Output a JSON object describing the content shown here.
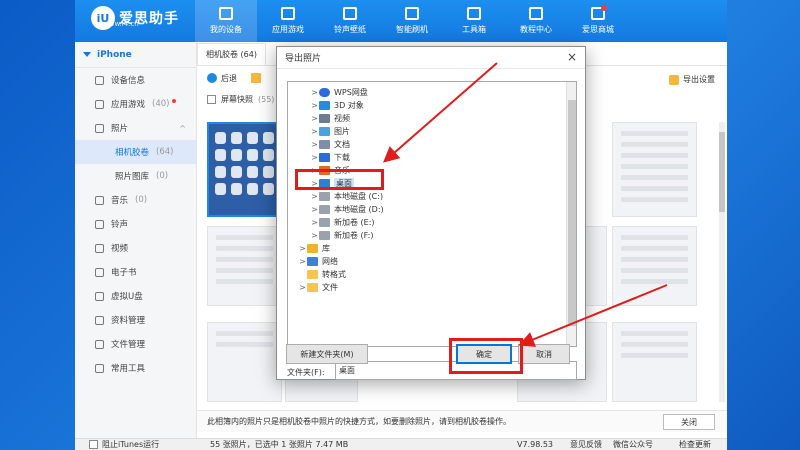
{
  "app": {
    "logo_text": "爱思助手",
    "logo_url": "www.i4.cn",
    "logo_mark": "iU",
    "nav": [
      {
        "label": "我的设备",
        "icon": "device-icon",
        "active": true
      },
      {
        "label": "应用游戏",
        "icon": "apps-icon",
        "active": false
      },
      {
        "label": "铃声壁纸",
        "icon": "music-icon",
        "active": false
      },
      {
        "label": "智能刷机",
        "icon": "flash-icon",
        "active": false
      },
      {
        "label": "工具箱",
        "icon": "toolbox-icon",
        "active": false
      },
      {
        "label": "教程中心",
        "icon": "graduation-icon",
        "active": false
      },
      {
        "label": "爱思商城",
        "icon": "shop-icon",
        "active": false
      }
    ]
  },
  "sidebar": {
    "device_name": "iPhone",
    "items": [
      {
        "label": "设备信息",
        "count": ""
      },
      {
        "label": "应用游戏",
        "count": "(40)"
      },
      {
        "label": "照片",
        "count": ""
      },
      {
        "label": "相机胶卷",
        "count": "(64)"
      },
      {
        "label": "照片图库",
        "count": "(0)"
      },
      {
        "label": "音乐",
        "count": "(0)"
      },
      {
        "label": "铃声",
        "count": ""
      },
      {
        "label": "视频",
        "count": ""
      },
      {
        "label": "电子书",
        "count": ""
      },
      {
        "label": "虚拟U盘",
        "count": ""
      },
      {
        "label": "资料管理",
        "count": ""
      },
      {
        "label": "文件管理",
        "count": ""
      },
      {
        "label": "常用工具",
        "count": ""
      }
    ]
  },
  "main": {
    "tab": "相机胶卷 (64)",
    "toolbar": {
      "back": "后退",
      "export": "导出设置"
    },
    "select_label": "屏幕快照",
    "select_count": "(55)",
    "info": "此相簿内的照片只是相机胶卷中照片的快捷方式，如要删除照片，请到相机胶卷操作。",
    "close_button": "关闭"
  },
  "status": {
    "itunes_label": "阻止iTunes运行",
    "count_text": "55 张照片，已选中 1 张照片 7.47 MB",
    "version": "V7.98.53",
    "feedback": "意见反馈",
    "wechat": "微信公众号",
    "update": "检查更新"
  },
  "dialog": {
    "title": "导出照片",
    "tree": [
      {
        "label": "WPS网盘",
        "icon": "cloud"
      },
      {
        "label": "3D 对象",
        "icon": "cube"
      },
      {
        "label": "视频",
        "icon": "video"
      },
      {
        "label": "图片",
        "icon": "pic"
      },
      {
        "label": "文档",
        "icon": "doc"
      },
      {
        "label": "下载",
        "icon": "down"
      },
      {
        "label": "音乐",
        "icon": "music"
      },
      {
        "label": "桌面",
        "icon": "desk"
      },
      {
        "label": "本地磁盘 (C:)",
        "icon": "drive"
      },
      {
        "label": "本地磁盘 (D:)",
        "icon": "drive"
      },
      {
        "label": "新加卷 (E:)",
        "icon": "drive"
      },
      {
        "label": "新加卷 (F:)",
        "icon": "drive"
      },
      {
        "label": "库",
        "icon": "lib"
      },
      {
        "label": "网络",
        "icon": "net"
      },
      {
        "label": "转格式",
        "icon": "folder"
      },
      {
        "label": "文件",
        "icon": "folder"
      }
    ],
    "folder_label": "文件夹(F):",
    "folder_value": "桌面",
    "new_folder_button": "新建文件夹(M)",
    "ok_button": "确定",
    "cancel_button": "取消"
  },
  "colors": {
    "accent": "#1479e0",
    "annotation": "#e21b1b"
  }
}
